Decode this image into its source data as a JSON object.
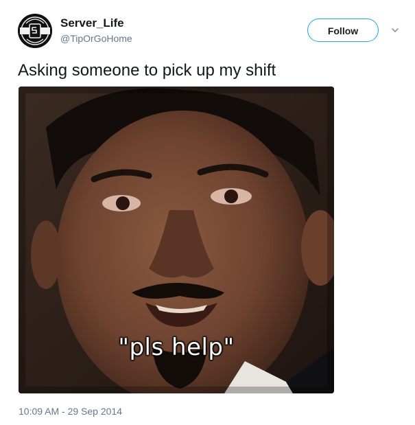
{
  "author": {
    "name": "Server_Life",
    "handle": "@TipOrGoHome",
    "avatar_icon": "server-life-logo"
  },
  "follow_button": {
    "label": "Follow"
  },
  "menu": {
    "icon": "chevron-down-icon"
  },
  "tweet": {
    "text": "Asking someone to pick up my shift",
    "timestamp": "10:09 AM - 29 Sep 2014"
  },
  "media": {
    "caption": "\"pls help\""
  },
  "colors": {
    "accent": "#1da1f2",
    "secondary_text": "#657786",
    "primary_text": "#14171a"
  }
}
